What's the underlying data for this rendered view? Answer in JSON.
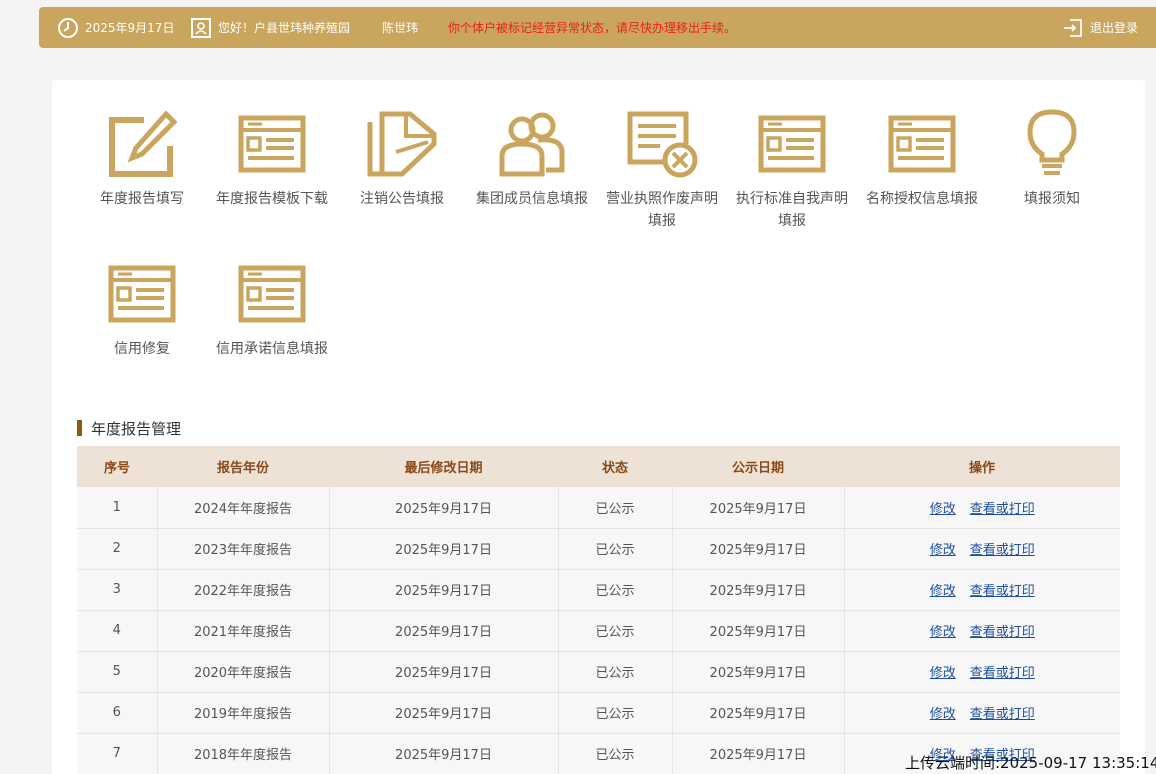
{
  "topbar": {
    "date": "2025年9月17日",
    "greeting": "您好！户县世玮种养殖园",
    "person": "陈世玮",
    "warning": "你个体户被标记经营异常状态，请尽快办理移出手续。",
    "logout": "退出登录"
  },
  "menu": [
    {
      "label": "年度报告填写",
      "icon": "pencil-edit-icon"
    },
    {
      "label": "年度报告模板下载",
      "icon": "form-document-icon"
    },
    {
      "label": "注销公告填报",
      "icon": "cancel-notice-icon"
    },
    {
      "label": "集团成员信息填报",
      "icon": "group-members-icon"
    },
    {
      "label": "营业执照作废声明填报",
      "icon": "license-void-icon"
    },
    {
      "label": "执行标准自我声明填报",
      "icon": "form-document-icon"
    },
    {
      "label": "名称授权信息填报",
      "icon": "form-document-icon"
    },
    {
      "label": "填报须知",
      "icon": "lightbulb-icon"
    },
    {
      "label": "信用修复",
      "icon": "form-document-icon"
    },
    {
      "label": "信用承诺信息填报",
      "icon": "form-document-icon"
    }
  ],
  "section_title": "年度报告管理",
  "table": {
    "headers": [
      "序号",
      "报告年份",
      "最后修改日期",
      "状态",
      "公示日期",
      "操作"
    ],
    "rows": [
      {
        "no": "1",
        "year": "2024年年度报告",
        "modified": "2025年9月17日",
        "status": "已公示",
        "published": "2025年9月17日"
      },
      {
        "no": "2",
        "year": "2023年年度报告",
        "modified": "2025年9月17日",
        "status": "已公示",
        "published": "2025年9月17日"
      },
      {
        "no": "3",
        "year": "2022年年度报告",
        "modified": "2025年9月17日",
        "status": "已公示",
        "published": "2025年9月17日"
      },
      {
        "no": "4",
        "year": "2021年年度报告",
        "modified": "2025年9月17日",
        "status": "已公示",
        "published": "2025年9月17日"
      },
      {
        "no": "5",
        "year": "2020年年度报告",
        "modified": "2025年9月17日",
        "status": "已公示",
        "published": "2025年9月17日"
      },
      {
        "no": "6",
        "year": "2019年年度报告",
        "modified": "2025年9月17日",
        "status": "已公示",
        "published": "2025年9月17日"
      },
      {
        "no": "7",
        "year": "2018年年度报告",
        "modified": "2025年9月17日",
        "status": "已公示",
        "published": "2025年9月17日"
      }
    ],
    "action_edit": "修改",
    "action_view": "查看或打印"
  },
  "upload_stamp": "上传云端时间:2025-09-17 13:35:14",
  "colors": {
    "topbar": "#c9a55e",
    "icon": "#c9a55e",
    "header_bg": "#ede2d5",
    "header_text": "#8a4a1a",
    "warning": "#e8221a",
    "link": "#1d4f9f"
  }
}
